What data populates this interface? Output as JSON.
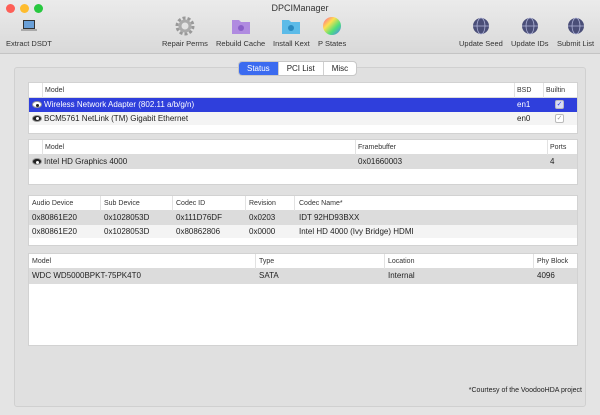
{
  "window": {
    "title": "DPCIManager"
  },
  "toolbar": {
    "items": [
      {
        "label": "Extract DSDT",
        "icon": "laptop-icon"
      },
      {
        "label": "Repair Perms",
        "icon": "gear-icon"
      },
      {
        "label": "Rebuild Cache",
        "icon": "purple-folder-icon"
      },
      {
        "label": "Install Kext",
        "icon": "blue-folder-icon"
      },
      {
        "label": "P States",
        "icon": "color-wheel-icon"
      },
      {
        "label": "Update Seed",
        "icon": "globe-icon"
      },
      {
        "label": "Update IDs",
        "icon": "globe-icon"
      },
      {
        "label": "Submit List",
        "icon": "globe-icon"
      }
    ]
  },
  "tabs": [
    {
      "label": "Status",
      "active": true
    },
    {
      "label": "PCI List"
    },
    {
      "label": "Misc"
    }
  ],
  "network": {
    "headers": [
      "Model",
      "BSD",
      "Builtin"
    ],
    "rows": [
      {
        "model": "Wireless Network Adapter (802.11 a/b/g/n)",
        "bsd": "en1",
        "builtin": true
      },
      {
        "model": "BCM5761 NetLink (TM) Gigabit Ethernet",
        "bsd": "en0",
        "builtin": true
      }
    ]
  },
  "graphics": {
    "headers": [
      "Model",
      "Framebuffer",
      "Ports"
    ],
    "rows": [
      {
        "model": "Intel HD Graphics 4000",
        "framebuffer": "0x01660003",
        "ports": "4"
      }
    ]
  },
  "audio": {
    "headers": [
      "Audio Device",
      "Sub Device",
      "Codec ID",
      "Revision",
      "Codec Name*"
    ],
    "rows": [
      [
        "0x80861E20",
        "0x1028053D",
        "0x111D76DF",
        "0x0203",
        "IDT 92HD93BXX"
      ],
      [
        "0x80861E20",
        "0x1028053D",
        "0x80862806",
        "0x0000",
        "Intel HD 4000 (Ivy Bridge) HDMI"
      ]
    ]
  },
  "storage": {
    "headers": [
      "Model",
      "Type",
      "Location",
      "Phy Block"
    ],
    "rows": [
      [
        "WDC WD5000BPKT-75PK4T0",
        "SATA",
        "Internal",
        "4096"
      ]
    ]
  },
  "footer": "*Courtesy of the VoodooHDA project"
}
